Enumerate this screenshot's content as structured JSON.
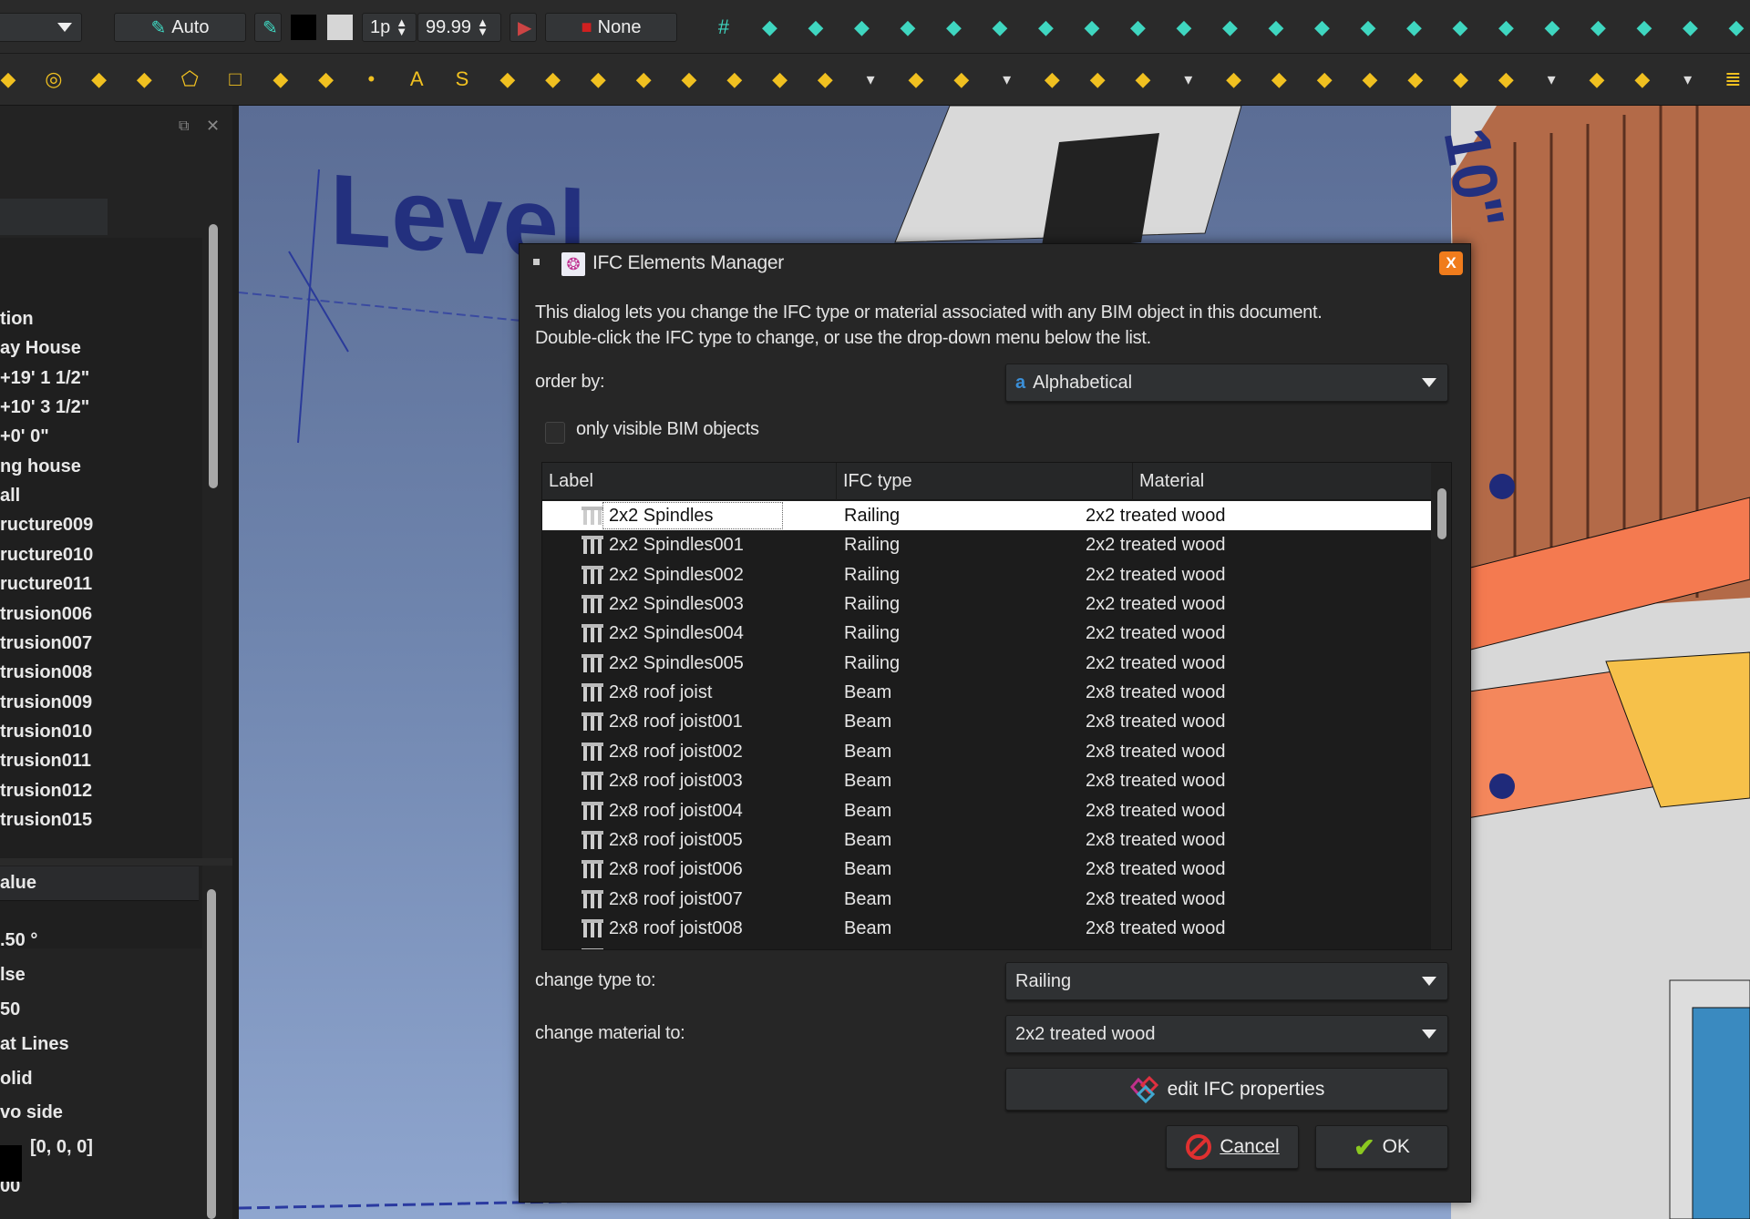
{
  "toolbar": {
    "draw_style": "Auto",
    "line_width": "1p",
    "font_size": "99.99",
    "hatch": "None",
    "row1_icons": [
      "grid-icon",
      "snap-lock-icon",
      "snap-endpoint-icon",
      "snap-dots-icon",
      "snap-parallel-icon",
      "snap-grid-icon",
      "snap-line-icon",
      "snap-extension-icon",
      "snap-perpendicular-icon",
      "snap-move-icon",
      "snap-center-icon",
      "snap-ortho-icon",
      "snap-intersection-icon",
      "snap-near-icon",
      "snap-dimension-icon",
      "snap-working-plane-icon",
      "tools-icon",
      "house-icon",
      "wall-icon",
      "material-icon",
      "ifc-icon",
      "view-icon",
      "book-icon"
    ],
    "row2_icons": [
      "polyline-icon",
      "circle-icon",
      "arc-icon",
      "ellipse-icon",
      "polygon-icon",
      "rectangle-icon",
      "bspline-icon",
      "bezier-icon",
      "point-icon",
      "text-icon",
      "shapestring-icon",
      "dimension-icon",
      "label-icon",
      "structure-frame-icon",
      "building-icon",
      "wall-tool-icon",
      "stairs-icon",
      "column-icon",
      "beam-icon",
      "dropdown-icon",
      "window-icon",
      "roof-icon",
      "dropdown-icon",
      "pipe-icon",
      "fence-icon",
      "equipment-icon",
      "dropdown-icon",
      "stairs-icon",
      "level-icon",
      "box-icon",
      "schedule-icon",
      "panel-icon",
      "frame-icon",
      "truss-icon",
      "dropdown-icon",
      "material-icon",
      "cluster-icon",
      "dropdown-icon",
      "list-icon"
    ]
  },
  "tree": {
    "items": [
      "tion",
      "ay House",
      "+19' 1 1/2\"",
      "+10' 3 1/2\"",
      "+0' 0\"",
      "ng house",
      "all",
      "ructure009",
      "ructure010",
      "ructure011",
      "trusion006",
      "trusion007",
      "trusion008",
      "trusion009",
      "trusion010",
      "trusion011",
      "trusion012",
      "trusion015"
    ]
  },
  "properties": {
    "header": "alue",
    "values": [
      ".50 °",
      "lse",
      "50",
      "at Lines",
      "olid",
      "vo side",
      "[0, 0, 0]",
      "00"
    ]
  },
  "viewport": {
    "level_text": "Level",
    "dim_text": "10\""
  },
  "dialog": {
    "title": "IFC Elements Manager",
    "close": "X",
    "description_1": "This dialog lets you change the IFC type or material associated with any BIM object in this document.",
    "description_2": "Double-click the IFC type to change, or use the drop-down menu below the list.",
    "order_by_label": "order by:",
    "order_by_value": "Alphabetical",
    "only_visible_label": "only visible BIM objects",
    "only_visible_checked": false,
    "columns": [
      "Label",
      "IFC type",
      "Material"
    ],
    "rows": [
      {
        "label": "2x2 Spindles",
        "type": "Railing",
        "material": "2x2 treated wood",
        "selected": true
      },
      {
        "label": "2x2 Spindles001",
        "type": "Railing",
        "material": "2x2 treated wood"
      },
      {
        "label": "2x2 Spindles002",
        "type": "Railing",
        "material": "2x2 treated wood"
      },
      {
        "label": "2x2 Spindles003",
        "type": "Railing",
        "material": "2x2 treated wood"
      },
      {
        "label": "2x2 Spindles004",
        "type": "Railing",
        "material": "2x2 treated wood"
      },
      {
        "label": "2x2 Spindles005",
        "type": "Railing",
        "material": "2x2 treated wood"
      },
      {
        "label": "2x8 roof joist",
        "type": "Beam",
        "material": "2x8 treated wood"
      },
      {
        "label": "2x8 roof joist001",
        "type": "Beam",
        "material": "2x8 treated wood"
      },
      {
        "label": "2x8 roof joist002",
        "type": "Beam",
        "material": "2x8 treated wood"
      },
      {
        "label": "2x8 roof joist003",
        "type": "Beam",
        "material": "2x8 treated wood"
      },
      {
        "label": "2x8 roof joist004",
        "type": "Beam",
        "material": "2x8 treated wood"
      },
      {
        "label": "2x8 roof joist005",
        "type": "Beam",
        "material": "2x8 treated wood"
      },
      {
        "label": "2x8 roof joist006",
        "type": "Beam",
        "material": "2x8 treated wood"
      },
      {
        "label": "2x8 roof joist007",
        "type": "Beam",
        "material": "2x8 treated wood"
      },
      {
        "label": "2x8 roof joist008",
        "type": "Beam",
        "material": "2x8 treated wood"
      }
    ],
    "change_type_label": "change type to:",
    "change_type_value": "Railing",
    "change_material_label": "change material to:",
    "change_material_value": "2x2 treated wood",
    "edit_ifc_label": "edit IFC properties",
    "cancel_label": "Cancel",
    "ok_label": "OK",
    "colors": {
      "close_button": "#f07c1c",
      "selected_row": "#ffffff",
      "accent": "#3b8fd8"
    }
  }
}
